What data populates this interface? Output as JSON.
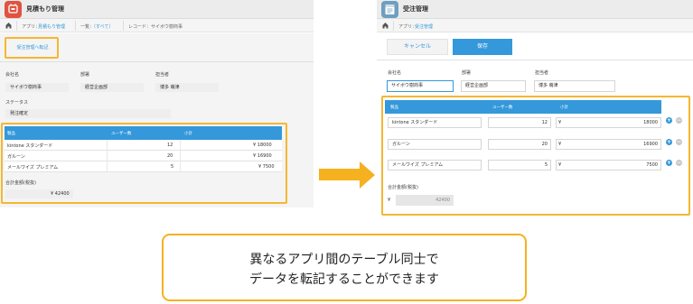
{
  "left": {
    "app_title": "見積もり管理",
    "breadcrumb": {
      "app_prefix": "アプリ：",
      "app_name": "見積もり管理",
      "list_prefix": "一覧：",
      "list_name": "（すべて）",
      "record": "レコード：サイボウ樹商事"
    },
    "transfer_button": "受注管理へ転記",
    "fields": {
      "company_label": "会社名",
      "company_value": "サイボウ樹商事",
      "dept_label": "部署",
      "dept_value": "経営企画部",
      "person_label": "担当者",
      "person_value": "博多 萌津",
      "status_label": "ステータス",
      "status_value": "発注確定"
    },
    "table": {
      "headers": [
        "製品",
        "ユーザー数",
        "小計"
      ],
      "rows": [
        {
          "product": "kintone スタンダード",
          "users": "12",
          "subtotal": "¥ 18000"
        },
        {
          "product": "ガルーン",
          "users": "20",
          "subtotal": "¥ 16900"
        },
        {
          "product": "メールワイズ プレミアム",
          "users": "5",
          "subtotal": "¥ 7500"
        }
      ]
    },
    "total_label": "合計金額(税抜)",
    "total_value": "¥ 42400"
  },
  "right": {
    "app_title": "受注管理",
    "breadcrumb": {
      "app_prefix": "アプリ：",
      "app_name": "受注管理"
    },
    "cancel_button": "キャンセル",
    "save_button": "保存",
    "fields": {
      "company_label": "会社名",
      "company_value": "サイボウ樹商事",
      "dept_label": "部署",
      "dept_value": "経営企画部",
      "person_label": "担当者",
      "person_value": "博多 萌津"
    },
    "table": {
      "headers": [
        "製品",
        "ユーザー数",
        "小計"
      ],
      "currency": "¥",
      "rows": [
        {
          "product": "kintone スタンダード",
          "users": "12",
          "subtotal": "18000"
        },
        {
          "product": "ガルーン",
          "users": "20",
          "subtotal": "16900"
        },
        {
          "product": "メールワイズ プレミアム",
          "users": "5",
          "subtotal": "7500"
        }
      ],
      "add_symbol": "+",
      "remove_symbol": "−"
    },
    "total_label": "合計金額(税抜)",
    "total_currency": "¥",
    "total_value": "42400"
  },
  "caption": {
    "line1": "異なるアプリ間のテーブル同士で",
    "line2": "データを転記することができます"
  },
  "colors": {
    "accent": "#3498db",
    "highlight": "#f5b120",
    "left_app_icon": "#e0533f",
    "right_app_icon": "#6f9fbf"
  },
  "icons": [
    "estimate-app-icon",
    "order-app-icon",
    "home-icon",
    "add-row-icon",
    "remove-row-icon",
    "right-arrow"
  ]
}
